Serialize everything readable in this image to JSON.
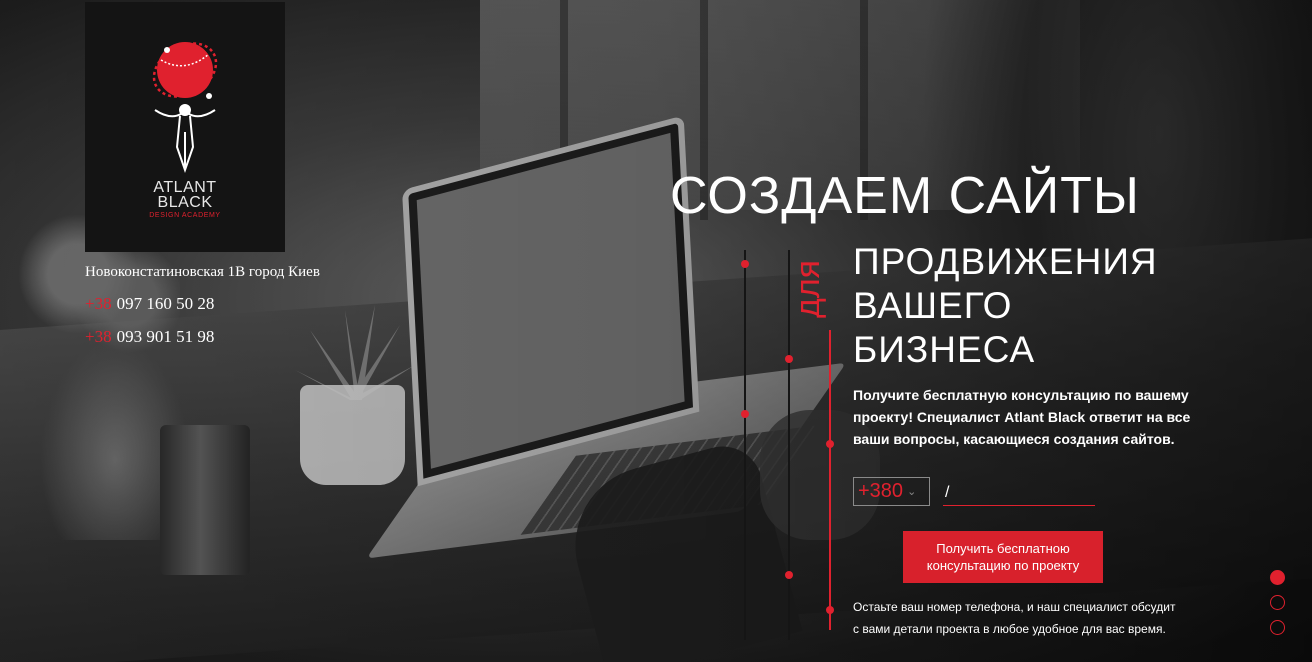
{
  "logo": {
    "line1": "ATLANT",
    "line2": "BLACK",
    "subtitle": "DESIGN ACADEMY",
    "icon": "atlas-globe-icon"
  },
  "contacts": {
    "address": "Новоконстатиновская 1В город Киев",
    "phones": [
      {
        "code": "+38",
        "number": "097 160 50 28"
      },
      {
        "code": "+38",
        "number": "093 901 51 98"
      }
    ]
  },
  "hero": {
    "title": "СОЗДАЕМ САЙТЫ",
    "for_word": "для",
    "subtitle_lines": [
      "ПРОДВИЖЕНИЯ",
      "ВАШЕГО",
      "БИЗНЕСА"
    ],
    "description": "Получите бесплатную консультацию по вашему проекту! Специалист Atlant Black ответит на все ваши вопросы, касающиеся создания сайтов."
  },
  "form": {
    "country_code": "+380",
    "phone_value": "/",
    "submit_label_line1": "Получить бесплатною",
    "submit_label_line2": "консультацию по проекту",
    "note_line1": "Остаьте ваш номер телефона, и наш специалист обсудит",
    "note_line2": "с вами детали проекта в любое удобное для вас время."
  },
  "slider": {
    "count": 3,
    "active_index": 0
  },
  "colors": {
    "accent": "#e0212e",
    "logo_bg": "#141414"
  }
}
